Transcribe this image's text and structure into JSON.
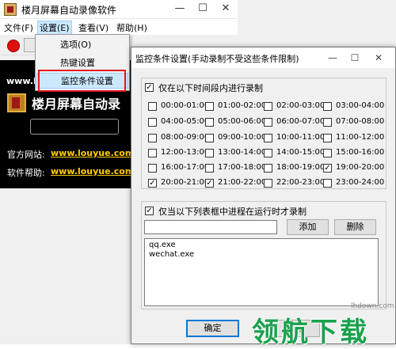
{
  "main_window": {
    "title": "楼月屏幕自动录像软件",
    "window_buttons": {
      "minimize": "—",
      "maximize": "☐",
      "close": "✕"
    },
    "menu": [
      {
        "label": "文件(F)"
      },
      {
        "label": "设置(E)",
        "open": true
      },
      {
        "label": "查看(V)"
      },
      {
        "label": "帮助(H)"
      }
    ],
    "banner": {
      "url_partial": "www.l",
      "app_title": "楼月屏幕自动录",
      "official_site_label": "官方网站:",
      "official_site_link": "www.louyue.com",
      "help_label": "软件帮助:",
      "help_link": "www.louyue.com"
    }
  },
  "settings_menu": {
    "items": [
      {
        "label": "选项(O)"
      },
      {
        "label": "热键设置"
      },
      {
        "label": "监控条件设置",
        "highlighted": true
      }
    ]
  },
  "dialog": {
    "title": "监控条件设置(手动录制不受这些条件限制)",
    "window_buttons": {
      "minimize": "—",
      "maximize": "☐",
      "close": "✕"
    },
    "time_group": {
      "enabled": true,
      "label": "仅在以下时间段内进行录制",
      "slots": [
        {
          "label": "00:00-01:00",
          "checked": false
        },
        {
          "label": "01:00-02:00",
          "checked": false
        },
        {
          "label": "02:00-03:00",
          "checked": false
        },
        {
          "label": "03:00-04:00",
          "checked": false
        },
        {
          "label": "04:00-05:00",
          "checked": false
        },
        {
          "label": "05:00-06:00",
          "checked": false
        },
        {
          "label": "06:00-07:00",
          "checked": false
        },
        {
          "label": "07:00-08:00",
          "checked": false
        },
        {
          "label": "08:00-09:00",
          "checked": false
        },
        {
          "label": "09:00-10:00",
          "checked": false
        },
        {
          "label": "10:00-11:00",
          "checked": false
        },
        {
          "label": "11:00-12:00",
          "checked": false
        },
        {
          "label": "12:00-13:00",
          "checked": false
        },
        {
          "label": "13:00-14:00",
          "checked": false
        },
        {
          "label": "14:00-15:00",
          "checked": false
        },
        {
          "label": "15:00-16:00",
          "checked": false
        },
        {
          "label": "16:00-17:00",
          "checked": false
        },
        {
          "label": "17:00-18:00",
          "checked": false
        },
        {
          "label": "18:00-19:00",
          "checked": false
        },
        {
          "label": "19:00-20:00",
          "checked": true
        },
        {
          "label": "20:00-21:00",
          "checked": true
        },
        {
          "label": "21:00-22:00",
          "checked": true
        },
        {
          "label": "22:00-23:00",
          "checked": false
        },
        {
          "label": "23:00-24:00",
          "checked": false
        }
      ]
    },
    "process_group": {
      "enabled": true,
      "label": "仅当以下列表框中进程在运行时才录制",
      "input_value": "",
      "add_button": "添加",
      "delete_button": "删除",
      "processes": [
        "qq.exe",
        "wechat.exe"
      ]
    },
    "ok_button": "确定",
    "cancel_button_partial": "取消"
  },
  "watermark": {
    "url": "lhdown.com",
    "text": "领航下载"
  }
}
